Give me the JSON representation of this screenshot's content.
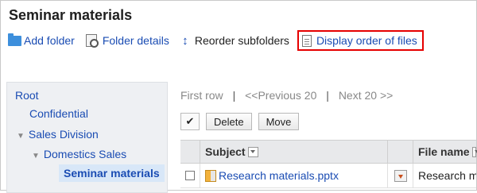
{
  "page": {
    "title": "Seminar materials"
  },
  "toolbar": {
    "add_folder": "Add folder",
    "folder_details": "Folder details",
    "reorder_subfolders": "Reorder subfolders",
    "display_order_of_files": "Display order of files"
  },
  "tree": {
    "items": [
      {
        "label": "Root"
      },
      {
        "label": "Confidential"
      },
      {
        "label": "Sales Division"
      },
      {
        "label": "Domestics Sales"
      },
      {
        "label": "Seminar materials"
      }
    ]
  },
  "pager": {
    "first_row": "First row",
    "separator": "|",
    "previous": "<<Previous 20",
    "next": "Next 20 >>"
  },
  "actions": {
    "check_all": "✔",
    "delete": "Delete",
    "move": "Move"
  },
  "table": {
    "columns": {
      "subject": "Subject",
      "file_name": "File name"
    },
    "rows": [
      {
        "subject": "Research materials.pptx",
        "file_name": "Research m"
      }
    ]
  },
  "colors": {
    "link": "#1a4cb3",
    "highlight_border": "#e60000",
    "sidebar_bg": "#eef0f3"
  },
  "icons": [
    "folder-icon",
    "folder-details-icon",
    "reorder-icon",
    "file-order-icon",
    "pptx-file-icon",
    "download-icon",
    "sort-dropdown-icon"
  ]
}
